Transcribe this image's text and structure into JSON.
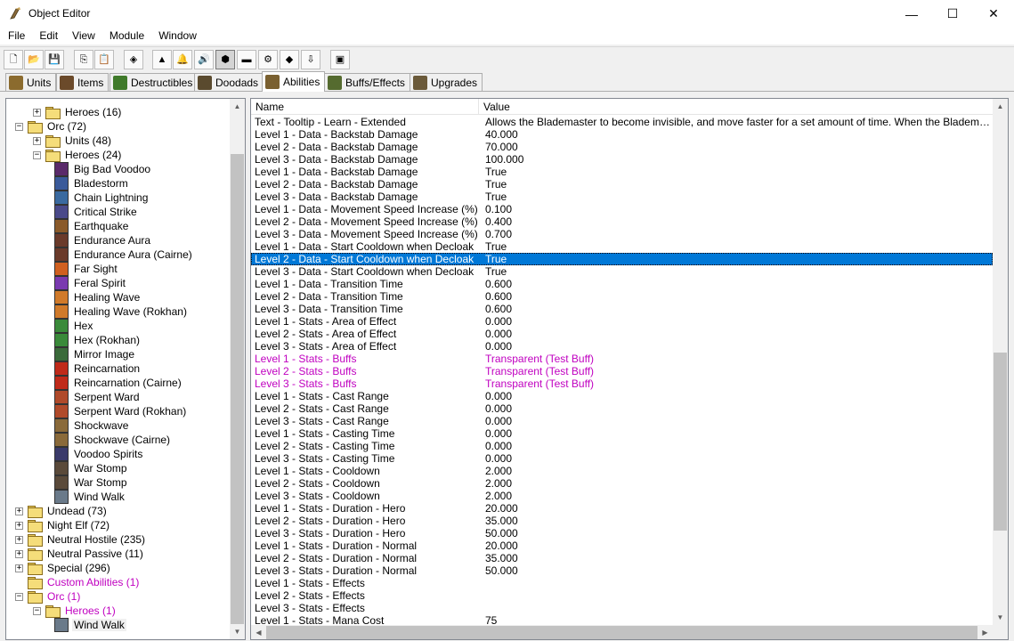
{
  "window": {
    "title": "Object Editor",
    "controls": {
      "minimize": "—",
      "maximize": "☐",
      "close": "✕"
    }
  },
  "menu": [
    "File",
    "Edit",
    "View",
    "Module",
    "Window"
  ],
  "toolbar": {
    "buttons": [
      {
        "name": "new-icon",
        "glyph": "🗋"
      },
      {
        "name": "open-icon",
        "glyph": "📂"
      },
      {
        "name": "save-icon",
        "glyph": "💾"
      },
      {
        "name": "copy-icon",
        "glyph": "⎘"
      },
      {
        "name": "paste-icon",
        "glyph": "📋"
      },
      {
        "name": "unit-module-icon",
        "glyph": "◈"
      },
      {
        "name": "terrain-icon",
        "glyph": "▲"
      },
      {
        "name": "sound-icon",
        "glyph": "🔔"
      },
      {
        "name": "speaker-icon",
        "glyph": "🔊"
      },
      {
        "name": "doodad-icon",
        "glyph": "⬢"
      },
      {
        "name": "camera-icon",
        "glyph": "▬"
      },
      {
        "name": "trigger-icon",
        "glyph": "⚙"
      },
      {
        "name": "object-editor-icon",
        "glyph": "◆"
      },
      {
        "name": "import-icon",
        "glyph": "⇩"
      },
      {
        "name": "test-map-icon",
        "glyph": "▣"
      }
    ]
  },
  "tabs": [
    {
      "label": "Units",
      "color": "#8b6b2e"
    },
    {
      "label": "Items",
      "color": "#6b4a2a"
    },
    {
      "label": "Destructibles",
      "color": "#3f7a2a"
    },
    {
      "label": "Doodads",
      "color": "#5a4a2e"
    },
    {
      "label": "Abilities",
      "color": "#7a6030",
      "active": true
    },
    {
      "label": "Buffs/Effects",
      "color": "#556b2f"
    },
    {
      "label": "Upgrades",
      "color": "#6b5a3a"
    }
  ],
  "tree": {
    "nodes": [
      {
        "label": "Heroes (16)",
        "type": "folder",
        "depth": 1,
        "exp": "+"
      },
      {
        "label": "Orc (72)",
        "type": "folder-open",
        "depth": 0,
        "exp": "−"
      },
      {
        "label": "Units (48)",
        "type": "folder",
        "depth": 1,
        "exp": "+"
      },
      {
        "label": "Heroes (24)",
        "type": "folder-open",
        "depth": 1,
        "exp": "−"
      },
      {
        "label": "Big Bad Voodoo",
        "type": "ability",
        "depth": 2,
        "icon": "#5a2a6a"
      },
      {
        "label": "Bladestorm",
        "type": "ability",
        "depth": 2,
        "icon": "#3a5a9a"
      },
      {
        "label": "Chain Lightning",
        "type": "ability",
        "depth": 2,
        "icon": "#3a6aa0"
      },
      {
        "label": "Critical Strike",
        "type": "ability",
        "depth": 2,
        "icon": "#4a4a8a"
      },
      {
        "label": "Earthquake",
        "type": "ability",
        "depth": 2,
        "icon": "#8a5a2a"
      },
      {
        "label": "Endurance Aura",
        "type": "ability",
        "depth": 2,
        "icon": "#6a3a2a"
      },
      {
        "label": "Endurance Aura (Cairne)",
        "type": "ability",
        "depth": 2,
        "icon": "#6a3a2a"
      },
      {
        "label": "Far Sight",
        "type": "ability",
        "depth": 2,
        "icon": "#d06020"
      },
      {
        "label": "Feral Spirit",
        "type": "ability",
        "depth": 2,
        "icon": "#7a3ab0"
      },
      {
        "label": "Healing Wave",
        "type": "ability",
        "depth": 2,
        "icon": "#d07a2a"
      },
      {
        "label": "Healing Wave (Rokhan)",
        "type": "ability",
        "depth": 2,
        "icon": "#d07a2a"
      },
      {
        "label": "Hex",
        "type": "ability",
        "depth": 2,
        "icon": "#3a8a3a"
      },
      {
        "label": "Hex (Rokhan)",
        "type": "ability",
        "depth": 2,
        "icon": "#3a8a3a"
      },
      {
        "label": "Mirror Image",
        "type": "ability",
        "depth": 2,
        "icon": "#3a6a3a"
      },
      {
        "label": "Reincarnation",
        "type": "ability",
        "depth": 2,
        "icon": "#c02a1a"
      },
      {
        "label": "Reincarnation (Cairne)",
        "type": "ability",
        "depth": 2,
        "icon": "#c02a1a"
      },
      {
        "label": "Serpent Ward",
        "type": "ability",
        "depth": 2,
        "icon": "#b04a2a"
      },
      {
        "label": "Serpent Ward (Rokhan)",
        "type": "ability",
        "depth": 2,
        "icon": "#b04a2a"
      },
      {
        "label": "Shockwave",
        "type": "ability",
        "depth": 2,
        "icon": "#8a6a3a"
      },
      {
        "label": "Shockwave (Cairne)",
        "type": "ability",
        "depth": 2,
        "icon": "#8a6a3a"
      },
      {
        "label": "Voodoo Spirits",
        "type": "ability",
        "depth": 2,
        "icon": "#3a3a6a"
      },
      {
        "label": "War Stomp",
        "type": "ability",
        "depth": 2,
        "icon": "#5a4a3a"
      },
      {
        "label": "War Stomp",
        "type": "ability",
        "depth": 2,
        "icon": "#5a4a3a"
      },
      {
        "label": "Wind Walk",
        "type": "ability",
        "depth": 2,
        "icon": "#6a7a8a"
      },
      {
        "label": "Undead (73)",
        "type": "folder",
        "depth": 0,
        "exp": "+"
      },
      {
        "label": "Night Elf (72)",
        "type": "folder",
        "depth": 0,
        "exp": "+"
      },
      {
        "label": "Neutral Hostile (235)",
        "type": "folder",
        "depth": 0,
        "exp": "+"
      },
      {
        "label": "Neutral Passive (11)",
        "type": "folder",
        "depth": 0,
        "exp": "+"
      },
      {
        "label": "Special (296)",
        "type": "folder",
        "depth": 0,
        "exp": "+"
      },
      {
        "label": "Custom Abilities (1)",
        "type": "folder-open",
        "depth": 0,
        "custom": true
      },
      {
        "label": "Orc (1)",
        "type": "folder-open",
        "depth": 0,
        "exp": "−",
        "custom": true
      },
      {
        "label": "Heroes (1)",
        "type": "folder-open",
        "depth": 1,
        "exp": "−",
        "custom": true
      },
      {
        "label": "Wind Walk",
        "type": "ability",
        "depth": 2,
        "icon": "#6a7a8a",
        "selected": true
      }
    ]
  },
  "grid": {
    "columns": [
      "Name",
      "Value"
    ],
    "rows": [
      {
        "name": "Text - Tooltip - Learn - Extended",
        "value": "Allows the Blademaster to become invisible, and move faster for a set amount of time. When the Blademaster attacks a unit, he will become visible."
      },
      {
        "name": "Level 1 - Data - Backstab Damage",
        "value": "40.000"
      },
      {
        "name": "Level 2 - Data - Backstab Damage",
        "value": "70.000"
      },
      {
        "name": "Level 3 - Data - Backstab Damage",
        "value": "100.000"
      },
      {
        "name": "Level 1 - Data - Backstab Damage",
        "value": "True"
      },
      {
        "name": "Level 2 - Data - Backstab Damage",
        "value": "True"
      },
      {
        "name": "Level 3 - Data - Backstab Damage",
        "value": "True"
      },
      {
        "name": "Level 1 - Data - Movement Speed Increase (%)",
        "value": "0.100"
      },
      {
        "name": "Level 2 - Data - Movement Speed Increase (%)",
        "value": "0.400"
      },
      {
        "name": "Level 3 - Data - Movement Speed Increase (%)",
        "value": "0.700"
      },
      {
        "name": "Level 1 - Data - Start Cooldown when Decloak",
        "value": "True"
      },
      {
        "name": "Level 2 - Data - Start Cooldown when Decloak",
        "value": "True",
        "selected": true
      },
      {
        "name": "Level 3 - Data - Start Cooldown when Decloak",
        "value": "True"
      },
      {
        "name": "Level 1 - Data - Transition Time",
        "value": "0.600"
      },
      {
        "name": "Level 2 - Data - Transition Time",
        "value": "0.600"
      },
      {
        "name": "Level 3 - Data - Transition Time",
        "value": "0.600"
      },
      {
        "name": "Level 1 - Stats - Area of Effect",
        "value": "0.000"
      },
      {
        "name": "Level 2 - Stats - Area of Effect",
        "value": "0.000"
      },
      {
        "name": "Level 3 - Stats - Area of Effect",
        "value": "0.000"
      },
      {
        "name": "Level 1 - Stats - Buffs",
        "value": "Transparent (Test Buff)",
        "modified": true
      },
      {
        "name": "Level 2 - Stats - Buffs",
        "value": "Transparent (Test Buff)",
        "modified": true
      },
      {
        "name": "Level 3 - Stats - Buffs",
        "value": "Transparent (Test Buff)",
        "modified": true
      },
      {
        "name": "Level 1 - Stats - Cast Range",
        "value": "0.000"
      },
      {
        "name": "Level 2 - Stats - Cast Range",
        "value": "0.000"
      },
      {
        "name": "Level 3 - Stats - Cast Range",
        "value": "0.000"
      },
      {
        "name": "Level 1 - Stats - Casting Time",
        "value": "0.000"
      },
      {
        "name": "Level 2 - Stats - Casting Time",
        "value": "0.000"
      },
      {
        "name": "Level 3 - Stats - Casting Time",
        "value": "0.000"
      },
      {
        "name": "Level 1 - Stats - Cooldown",
        "value": "2.000"
      },
      {
        "name": "Level 2 - Stats - Cooldown",
        "value": "2.000"
      },
      {
        "name": "Level 3 - Stats - Cooldown",
        "value": "2.000"
      },
      {
        "name": "Level 1 - Stats - Duration - Hero",
        "value": "20.000"
      },
      {
        "name": "Level 2 - Stats - Duration - Hero",
        "value": "35.000"
      },
      {
        "name": "Level 3 - Stats - Duration - Hero",
        "value": "50.000"
      },
      {
        "name": "Level 1 - Stats - Duration - Normal",
        "value": "20.000"
      },
      {
        "name": "Level 2 - Stats - Duration - Normal",
        "value": "35.000"
      },
      {
        "name": "Level 3 - Stats - Duration - Normal",
        "value": "50.000"
      },
      {
        "name": "Level 1 - Stats - Effects",
        "value": ""
      },
      {
        "name": "Level 2 - Stats - Effects",
        "value": ""
      },
      {
        "name": "Level 3 - Stats - Effects",
        "value": ""
      },
      {
        "name": "Level 1 - Stats - Mana Cost",
        "value": "75"
      }
    ]
  },
  "colors": {
    "selection": "#0078d7",
    "modified_text": "#c000c0"
  },
  "scroll": {
    "tree_scroll_position": 0.1,
    "grid_scroll_position": 0.55
  }
}
